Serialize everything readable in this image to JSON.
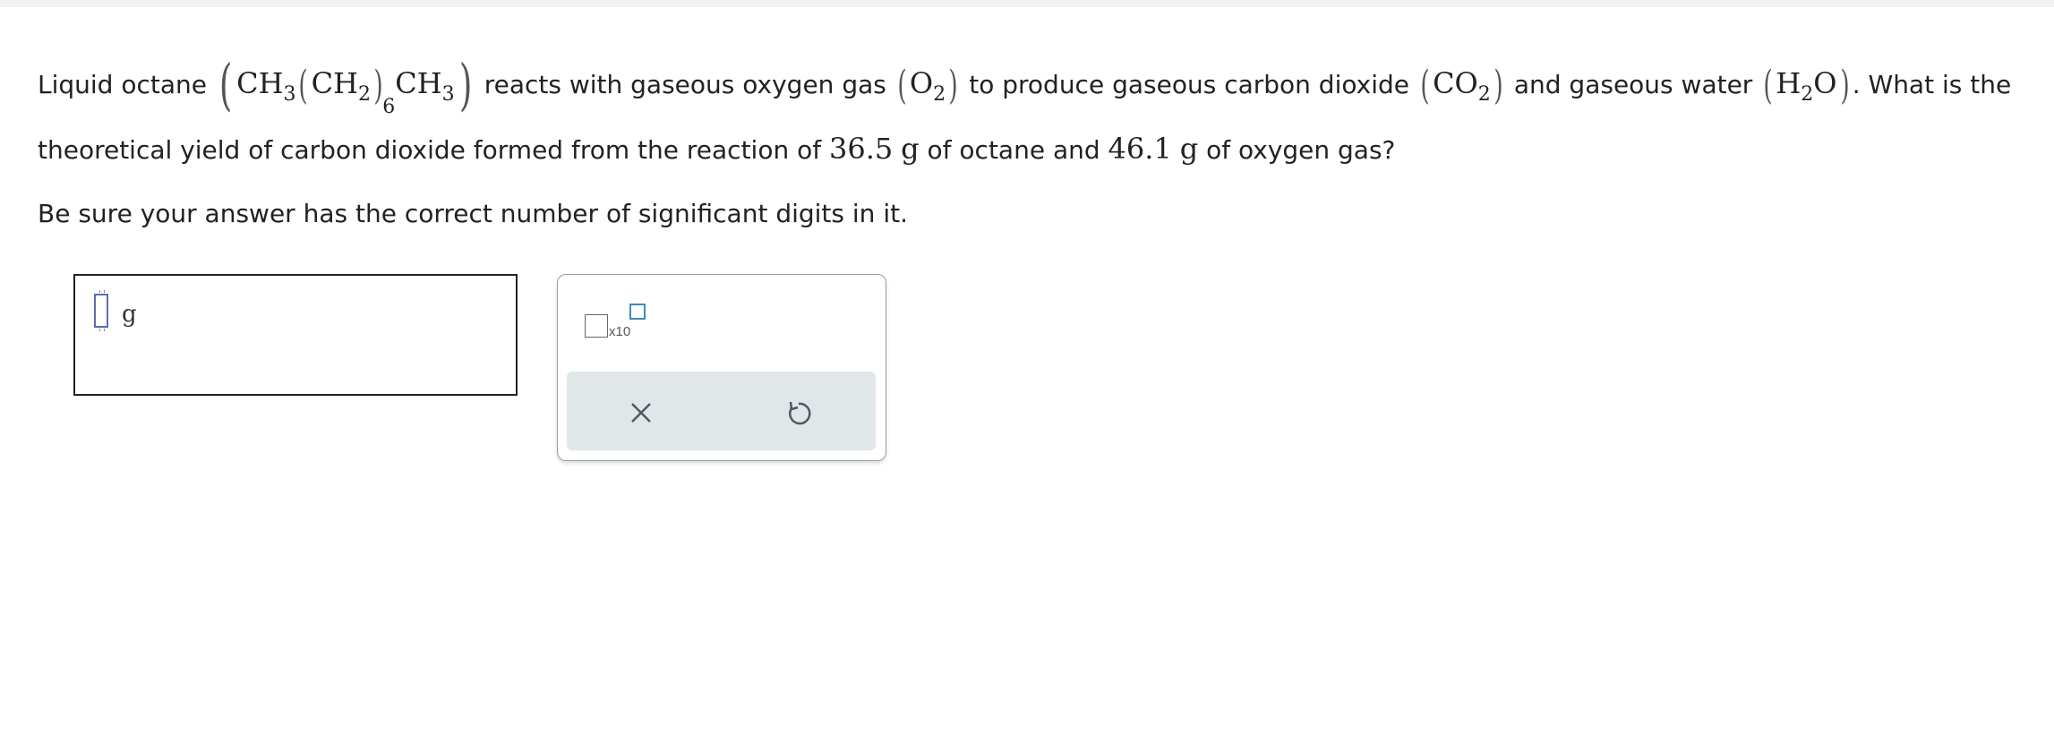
{
  "question": {
    "line1": {
      "prefix": "Liquid octane ",
      "octane_formula": {
        "ch3a": "CH",
        "sub3a": "3",
        "ch2": "CH",
        "sub2": "2",
        "sub6": "6",
        "ch3b": "CH",
        "sub3b": "3"
      },
      "mid1": " reacts with gaseous oxygen gas ",
      "oxygen_formula": {
        "o": "O",
        "sub": "2"
      },
      "mid2": " to produce gaseous carbon dioxide ",
      "co2_formula": {
        "co": "CO",
        "sub": "2"
      },
      "mid3": " and gaseous water ",
      "water_formula": {
        "h": "H",
        "sub": "2",
        "o": "O"
      },
      "suffix": ". What is the"
    },
    "line2": {
      "prefix": "theoretical yield of carbon dioxide formed from the reaction of ",
      "mass1": "36.5",
      "unit1": "g",
      "mid": " of octane and ",
      "mass2": "46.1",
      "unit2": "g",
      "suffix": " of oxygen gas?"
    },
    "line3": "Be sure your answer has the correct number of significant digits in it."
  },
  "answer": {
    "value": "",
    "unit": "g"
  },
  "tools": {
    "x10_label": "x10",
    "clear_icon": "close-x-icon",
    "undo_icon": "undo-icon"
  },
  "colors": {
    "exponent_box": "#3a8fb0",
    "cursor": "#5a6ab8",
    "panel_footer": "#e1e6e9"
  }
}
